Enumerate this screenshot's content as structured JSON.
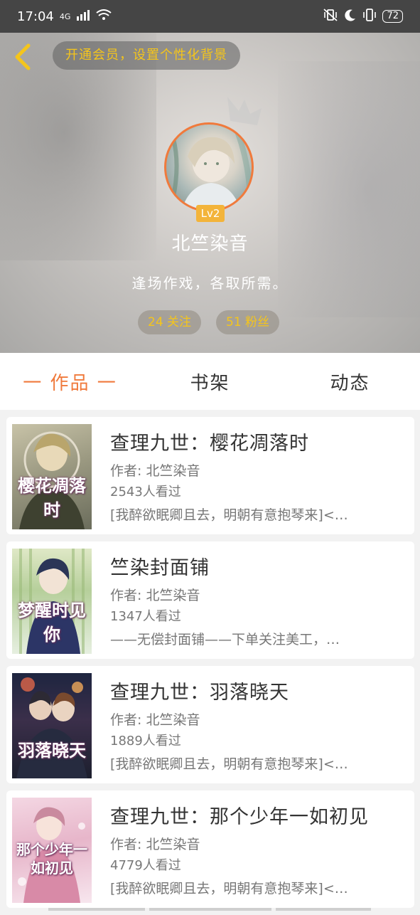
{
  "status_bar": {
    "time": "17:04",
    "network": "4G",
    "battery": "72"
  },
  "header": {
    "vip_banner": "开通会员，设置个性化背景",
    "level": "Lv2",
    "username": "北竺染音",
    "bio": "逢场作戏，各取所需。",
    "following": "24 关注",
    "fans": "51 粉丝"
  },
  "tabs": [
    {
      "label": "一 作品 一",
      "active": true
    },
    {
      "label": "书架",
      "active": false
    },
    {
      "label": "动态",
      "active": false
    }
  ],
  "works": [
    {
      "title": "查理九世：樱花凋落时",
      "author": "作者: 北竺染音",
      "views": "2543人看过",
      "desc": "[我醉欲眠卿且去，明朝有意抱琴来]<…",
      "cover_text": "樱花凋落时"
    },
    {
      "title": "竺染封面铺",
      "author": "作者: 北竺染音",
      "views": "1347人看过",
      "desc": "——无偿封面铺——下单关注美工，…",
      "cover_text": "梦醒时见你"
    },
    {
      "title": "查理九世：羽落晓天",
      "author": "作者: 北竺染音",
      "views": "1889人看过",
      "desc": "[我醉欲眠卿且去，明朝有意抱琴来]<…",
      "cover_text": "羽落晓天"
    },
    {
      "title": "查理九世：那个少年一如初见",
      "author": "作者: 北竺染音",
      "views": "4779人看过",
      "desc": "[我醉欲眠卿且去，明朝有意抱琴来]<…",
      "cover_text": "那个少年一如初见"
    }
  ],
  "colors": {
    "accent": "#f07a3c",
    "gold": "#f5c51b"
  }
}
